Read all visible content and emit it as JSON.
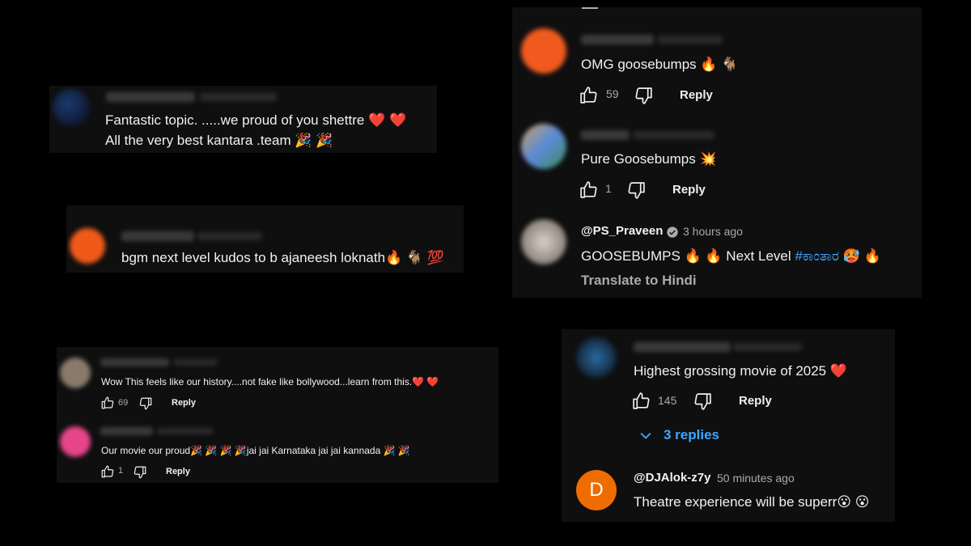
{
  "panel1": {
    "text_line1": "Fantastic  topic. .....we proud of you shettre ❤️ ❤️",
    "text_line2": "All the very best kantara .team 🎉 🎉"
  },
  "panel2": {
    "text": "bgm next level kudos to b ajaneesh loknath🔥 🐐 💯"
  },
  "panel3": {
    "comment1": {
      "text": "Wow This feels like our history....not fake like bollywood...learn from this.❤️ ❤️",
      "likes": "69",
      "reply": "Reply"
    },
    "comment2": {
      "text": "Our movie our proud🎉 🎉 🎉 🎉jai jai Karnataka jai jai kannada 🎉 🎉",
      "likes": "1",
      "reply": "Reply"
    }
  },
  "panel4": {
    "comment1": {
      "text": "OMG goosebumps 🔥 🐐",
      "likes": "59",
      "reply": "Reply"
    },
    "comment2": {
      "text": "Pure Goosebumps 💥",
      "likes": "1",
      "reply": "Reply"
    },
    "comment3": {
      "handle": "@PS_Praveen",
      "time": "3 hours ago",
      "text_prefix": "GOOSEBUMPS 🔥 🔥  Next Level ",
      "hashtag": "#ಕಾಂತಾರ",
      "text_suffix": " 🥵 🔥",
      "translate": "Translate to Hindi"
    }
  },
  "panel5": {
    "comment1": {
      "text": "Highest grossing movie of 2025 ❤️",
      "likes": "145",
      "reply": "Reply",
      "replies": "3 replies"
    },
    "comment2": {
      "avatar_letter": "D",
      "handle": "@DJAlok-z7y",
      "time": "50 minutes ago",
      "text": "Theatre experience will be superr😮 😮"
    }
  },
  "colors": {
    "background": "#000000",
    "panel": "#0f0f0f",
    "link": "#3ea6ff",
    "avatar_orange": "#ef6c00"
  }
}
